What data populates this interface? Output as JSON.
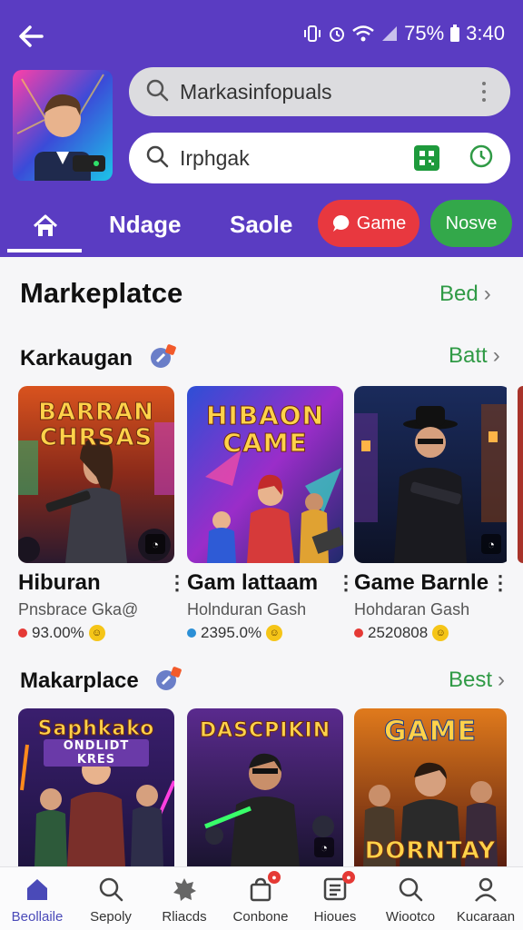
{
  "status_bar": {
    "battery": "75%",
    "time": "3:40"
  },
  "search": {
    "primary_text": "Markasinfopuals",
    "secondary_text": "Irphgak"
  },
  "tabs": {
    "tab1": "Ndage",
    "tab2": "Saole",
    "pill_red": "Game",
    "pill_green": "Nosve"
  },
  "marketplace": {
    "title": "Markeplatce",
    "link": "Bed"
  },
  "section1": {
    "title": "Karkaugan",
    "link": "Batt",
    "cards": [
      {
        "thumb_title_1": "BARRAN",
        "thumb_title_2": "CHRSAS",
        "title": "Hiburan",
        "subtitle": "Pnsbrace Gka@",
        "stat": "93.00%",
        "dot_color": "#e53935"
      },
      {
        "thumb_title_1": "HIBAON",
        "thumb_title_2": "CAME",
        "title": "Gam lattaam",
        "subtitle": "Holnduran Gash",
        "stat": "2395.0%",
        "dot_color": "#2b8fd6"
      },
      {
        "title": "Game Barnle",
        "subtitle": "Hohdaran Gash",
        "stat": "2520808",
        "dot_color": "#e53935"
      }
    ]
  },
  "section2": {
    "title": "Makarplace",
    "link": "Best",
    "cards": [
      {
        "thumb_title_1": "Saphkako",
        "thumb_title_2": "ONDLIDT KRES"
      },
      {
        "thumb_title_1": "DASCPIKIN"
      },
      {
        "thumb_title_1": "GAME",
        "thumb_title_2": "DORNTAY"
      }
    ]
  },
  "bottom_nav": [
    {
      "label": "Beollaile",
      "icon": "home-icon"
    },
    {
      "label": "Sepoly",
      "icon": "search-icon"
    },
    {
      "label": "Rliacds",
      "icon": "puzzle-icon"
    },
    {
      "label": "Conbone",
      "icon": "bag-icon"
    },
    {
      "label": "Hioues",
      "icon": "list-icon"
    },
    {
      "label": "Wiootco",
      "icon": "search-icon"
    },
    {
      "label": "Kucaraan",
      "icon": "user-icon"
    }
  ],
  "colors": {
    "header": "#5a3cc2",
    "accent_green": "#2f9a45",
    "pill_red": "#e8383f",
    "pill_green": "#33a84a"
  }
}
